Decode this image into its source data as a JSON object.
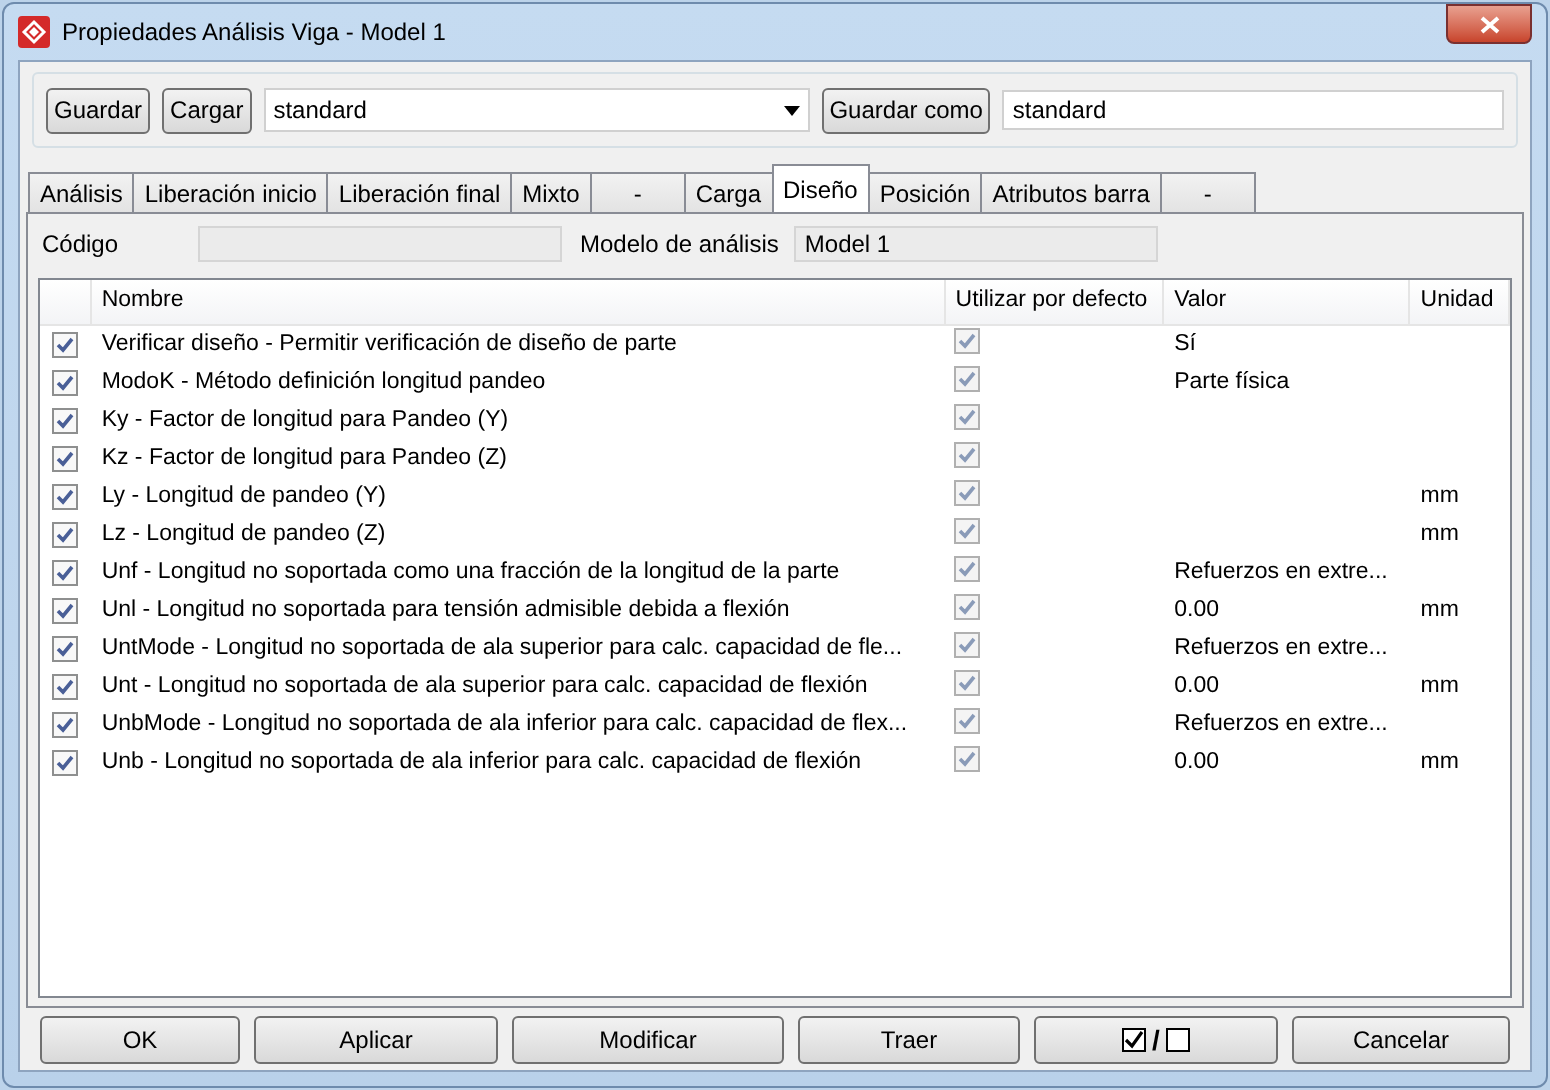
{
  "window": {
    "title": "Propiedades Análisis Viga - Model 1"
  },
  "toolbar": {
    "save": "Guardar",
    "load": "Cargar",
    "preset": "standard",
    "save_as": "Guardar como",
    "save_as_name": "standard"
  },
  "tabs": [
    {
      "label": "Análisis",
      "selected": false
    },
    {
      "label": "Liberación inicio",
      "selected": false
    },
    {
      "label": "Liberación final",
      "selected": false
    },
    {
      "label": "Mixto",
      "selected": false
    },
    {
      "label": "-",
      "selected": false
    },
    {
      "label": "Carga",
      "selected": false
    },
    {
      "label": "Diseño",
      "selected": true
    },
    {
      "label": "Posición",
      "selected": false
    },
    {
      "label": "Atributos barra",
      "selected": false
    },
    {
      "label": "-",
      "selected": false
    }
  ],
  "fields": {
    "code_label": "Código",
    "model_label": "Modelo de análisis",
    "model_value": "Model 1"
  },
  "table": {
    "columns": [
      "Nombre",
      "Utilizar por defecto",
      "Valor",
      "Unidad"
    ],
    "rows": [
      {
        "checked": true,
        "name": "Verificar diseño - Permitir verificación de diseño de parte",
        "use_default": true,
        "value": "Sí",
        "unit": ""
      },
      {
        "checked": true,
        "name": "ModoK - Método definición longitud pandeo",
        "use_default": true,
        "value": "Parte física",
        "unit": ""
      },
      {
        "checked": true,
        "name": "Ky - Factor de longitud para Pandeo (Y)",
        "use_default": true,
        "value": "",
        "unit": ""
      },
      {
        "checked": true,
        "name": "Kz - Factor de longitud para Pandeo (Z)",
        "use_default": true,
        "value": "",
        "unit": ""
      },
      {
        "checked": true,
        "name": "Ly - Longitud de pandeo (Y)",
        "use_default": true,
        "value": "",
        "unit": "mm"
      },
      {
        "checked": true,
        "name": "Lz - Longitud de pandeo (Z)",
        "use_default": true,
        "value": "",
        "unit": "mm"
      },
      {
        "checked": true,
        "name": "Unf - Longitud no soportada como una fracción de la longitud de la parte",
        "use_default": true,
        "value": "Refuerzos en extre...",
        "unit": ""
      },
      {
        "checked": true,
        "name": "Unl - Longitud no soportada para tensión admisible debida a flexión",
        "use_default": true,
        "value": "0.00",
        "unit": "mm"
      },
      {
        "checked": true,
        "name": "UntMode - Longitud no soportada de ala superior para calc. capacidad de fle...",
        "use_default": true,
        "value": "Refuerzos en extre...",
        "unit": ""
      },
      {
        "checked": true,
        "name": "Unt - Longitud no soportada de ala superior para calc. capacidad de flexión",
        "use_default": true,
        "value": "0.00",
        "unit": "mm"
      },
      {
        "checked": true,
        "name": "UnbMode - Longitud no soportada de ala inferior para calc. capacidad de flex...",
        "use_default": true,
        "value": "Refuerzos en extre...",
        "unit": ""
      },
      {
        "checked": true,
        "name": "Unb - Longitud no soportada de ala inferior para calc. capacidad de flexión",
        "use_default": true,
        "value": "0.00",
        "unit": "mm"
      }
    ]
  },
  "buttons": {
    "ok": "OK",
    "apply": "Aplicar",
    "modify": "Modificar",
    "get": "Traer",
    "toggle_separator": "/",
    "cancel": "Cancelar"
  }
}
